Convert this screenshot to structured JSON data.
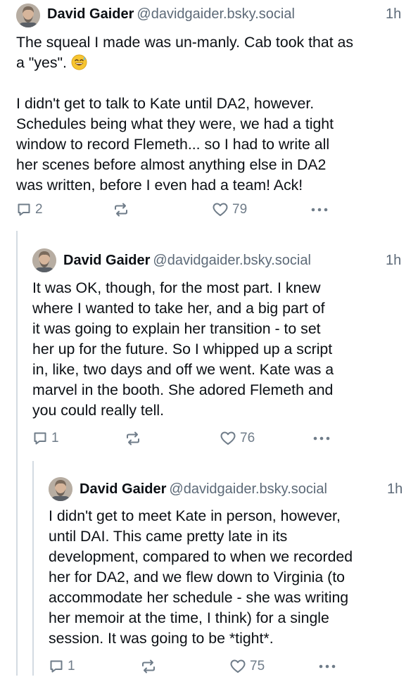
{
  "posts": [
    {
      "display_name": "David Gaider",
      "handle": "@davidgaider.bsky.social",
      "time": "1h",
      "text_line1": "The squeal I made was un-manly. Cab took that as",
      "text_line2": "a \"yes\".",
      "emoji": "sweat-smile-emoji",
      "text_rest": "I didn't get to talk to Kate until DA2, however.\nSchedules being what they were, we had a tight\nwindow to record Flemeth... so I had to write all\nher scenes before almost anything else in DA2\nwas written, before I even had a team! Ack!",
      "replies": "2",
      "reposts": "",
      "likes": "79"
    },
    {
      "display_name": "David Gaider",
      "handle": "@davidgaider.bsky.social",
      "time": "1h",
      "text": "It was OK, though, for the most part. I knew\nwhere I wanted to take her, and a big part of\nit was going to explain her transition - to set\nher up for the future. So I whipped up a script\nin, like, two days and off we went. Kate was a\nmarvel in the booth. She adored Flemeth and\nyou could really tell.",
      "replies": "1",
      "reposts": "",
      "likes": "76"
    },
    {
      "display_name": "David Gaider",
      "handle": "@davidgaider.bsky.social",
      "time": "1h",
      "text": "I didn't get to meet Kate in person, however,\nuntil DAI. This came pretty late in its\ndevelopment, compared to when we recorded\nher for DA2, and we flew down to Virginia (to\naccommodate her schedule - she was writing\nher memoir at the time, I think) for a single\nsession. It was going to be *tight*.",
      "replies": "1",
      "reposts": "",
      "likes": "75"
    }
  ],
  "icons": {
    "reply": "reply-icon",
    "repost": "repost-icon",
    "like": "like-icon",
    "more": "more-icon"
  },
  "colors": {
    "text": "#0b0f14",
    "muted": "#5d6a78",
    "icon": "#6f7c89",
    "thread_line": "#d4dbe2"
  }
}
